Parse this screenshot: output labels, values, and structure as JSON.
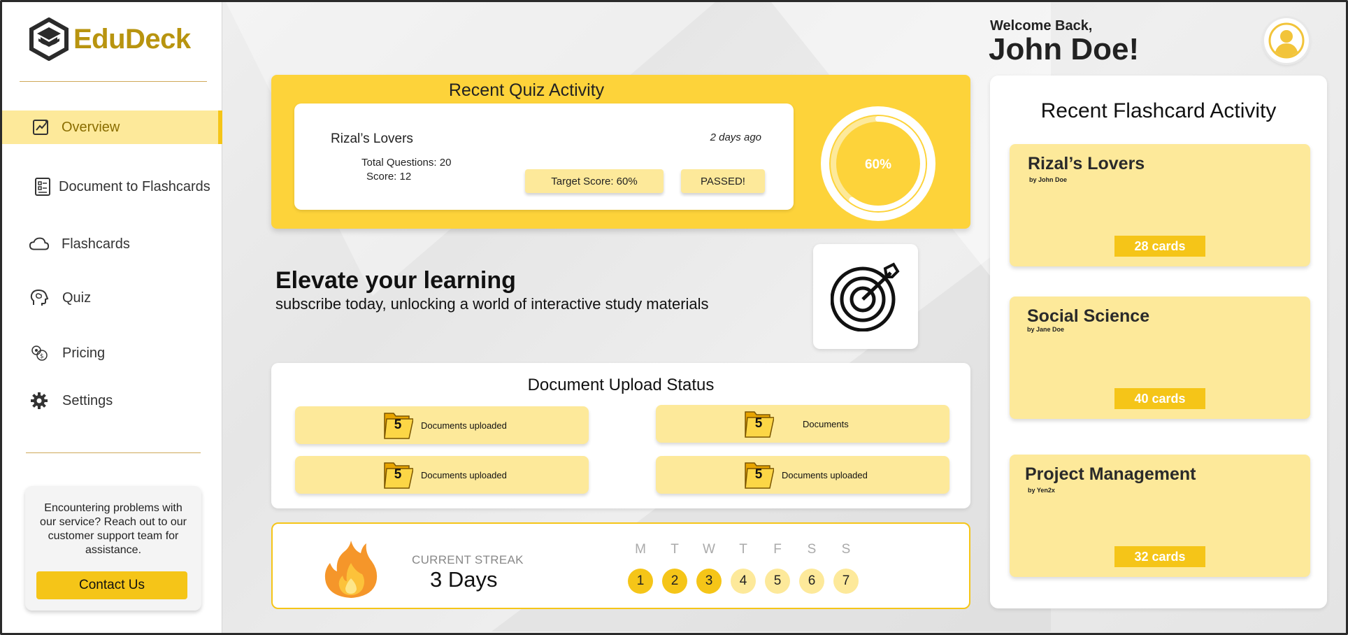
{
  "app": {
    "name": "EduDeck"
  },
  "sidebar": {
    "items": [
      {
        "label": "Overview",
        "icon": "chart-icon"
      },
      {
        "label": "Document to Flashcards",
        "icon": "document-icon"
      },
      {
        "label": "Flashcards",
        "icon": "cloud-icon"
      },
      {
        "label": "Quiz",
        "icon": "brain-icon"
      },
      {
        "label": "Pricing",
        "icon": "coins-icon"
      },
      {
        "label": "Settings",
        "icon": "gear-icon"
      }
    ],
    "support_text": "Encountering problems with our service? Reach out to our customer support team for assistance.",
    "contact_label": "Contact Us"
  },
  "quiz": {
    "section_title": "Recent Quiz Activity",
    "name": "Rizal’s Lovers",
    "when": "2 days ago",
    "total_questions": "Total Questions: 20",
    "score": "Score: 12",
    "target": "Target Score: 60%",
    "status": "PASSED!",
    "progress_label": "60%",
    "progress_value": 0.6
  },
  "promo": {
    "title": "Elevate your learning",
    "subtitle": "subscribe today, unlocking a world of interactive study materials"
  },
  "uploads": {
    "title": "Document Upload Status",
    "items": [
      {
        "count": "5",
        "label": "Documents uploaded"
      },
      {
        "count": "5",
        "label": "Documents"
      },
      {
        "count": "5",
        "label": "Documents uploaded"
      },
      {
        "count": "5",
        "label": "Documents uploaded"
      }
    ]
  },
  "streak": {
    "label": "CURRENT STREAK",
    "value": "3 Days",
    "days": [
      {
        "letter": "M",
        "num": "1",
        "done": true
      },
      {
        "letter": "T",
        "num": "2",
        "done": true
      },
      {
        "letter": "W",
        "num": "3",
        "done": true
      },
      {
        "letter": "T",
        "num": "4",
        "done": false
      },
      {
        "letter": "F",
        "num": "5",
        "done": false
      },
      {
        "letter": "S",
        "num": "6",
        "done": false
      },
      {
        "letter": "S",
        "num": "7",
        "done": false
      }
    ]
  },
  "user": {
    "greeting": "Welcome Back,",
    "name": "John Doe!"
  },
  "flashcards": {
    "title": "Recent Flashcard Activity",
    "items": [
      {
        "name": "Rizal’s Lovers",
        "by": "by John Doe",
        "count": "28 cards"
      },
      {
        "name": "Social Science",
        "by": "by Jane Doe",
        "count": "40 cards"
      },
      {
        "name": "Project Management",
        "by": "by Yen2x",
        "count": "32 cards"
      }
    ]
  },
  "colors": {
    "accent": "#f5c518",
    "accent_light": "#fde99a",
    "brand_text": "#b8940f"
  }
}
